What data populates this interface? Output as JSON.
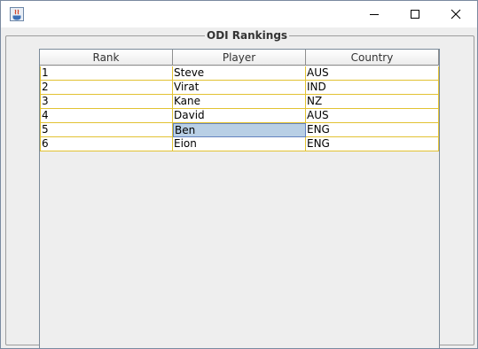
{
  "window": {
    "controls": {
      "minimize": "minimize",
      "maximize": "maximize",
      "close": "close"
    }
  },
  "panel": {
    "title": "ODI Rankings"
  },
  "table": {
    "columns": [
      "Rank",
      "Player",
      "Country"
    ],
    "rows": [
      [
        "1",
        "Steve",
        "AUS"
      ],
      [
        "2",
        "Virat",
        "IND"
      ],
      [
        "3",
        "Kane",
        "NZ"
      ],
      [
        "4",
        "David",
        "AUS"
      ],
      [
        "5",
        "Ben",
        "ENG"
      ],
      [
        "6",
        "Eion",
        "ENG"
      ]
    ],
    "selected_cell": {
      "row": 4,
      "column": 1
    }
  },
  "colors": {
    "grid_line": "#e2c233",
    "selection": "#b8cfe5",
    "background": "#eeeeee"
  }
}
